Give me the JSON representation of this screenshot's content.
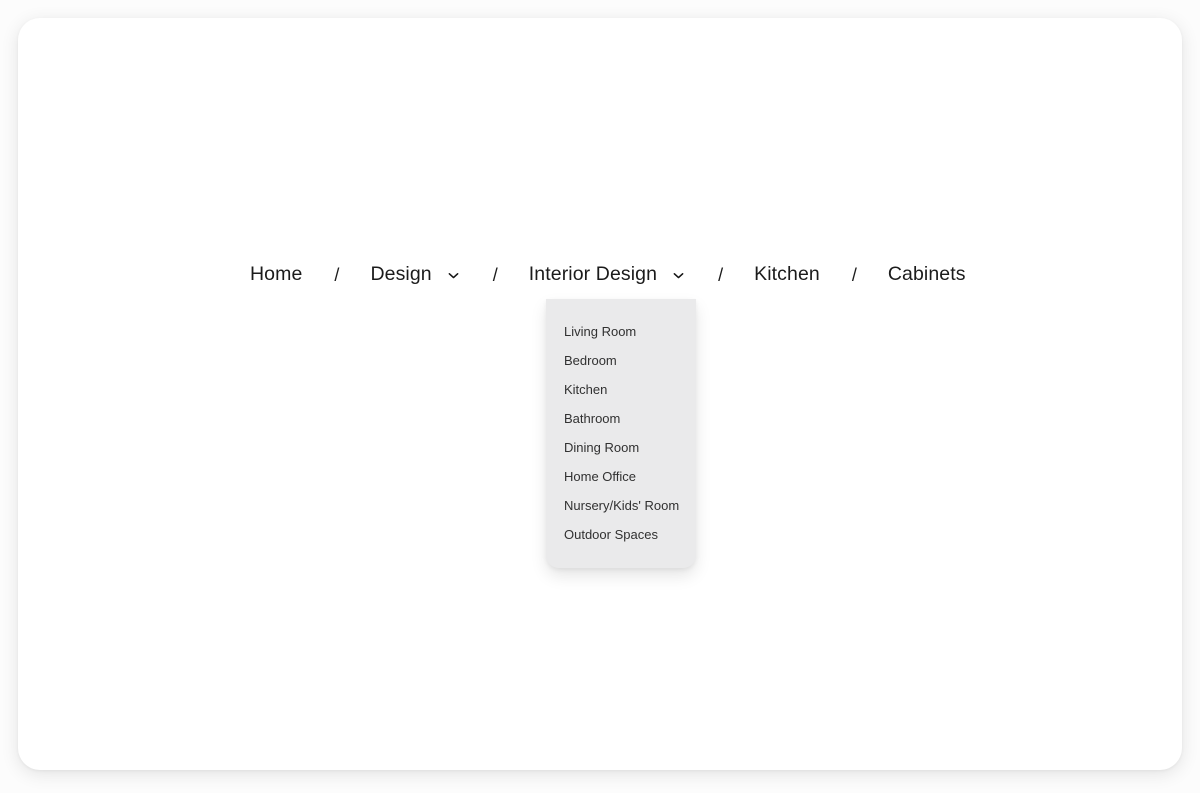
{
  "page": {
    "background_color": "#fcfcfc",
    "card_background_color": "#ffffff"
  },
  "breadcrumb": {
    "separator": "/",
    "items": [
      {
        "label": "Home",
        "has_chevron": false,
        "chevron_icon": "",
        "expanded": false
      },
      {
        "label": "Design",
        "has_chevron": true,
        "chevron_icon": "chevron-down-icon",
        "expanded": false
      },
      {
        "label": "Interior Design",
        "has_chevron": true,
        "chevron_icon": "chevron-down-icon",
        "expanded": true
      },
      {
        "label": "Kitchen",
        "has_chevron": false,
        "chevron_icon": "",
        "expanded": false
      },
      {
        "label": "Cabinets",
        "has_chevron": false,
        "chevron_icon": "",
        "expanded": false
      }
    ]
  },
  "dropdown": {
    "open_for": "Interior Design",
    "background_color": "#eaeaeb",
    "text_color": "#313131",
    "items": [
      {
        "label": "Living Room"
      },
      {
        "label": "Bedroom"
      },
      {
        "label": "Kitchen"
      },
      {
        "label": "Bathroom"
      },
      {
        "label": "Dining Room"
      },
      {
        "label": "Home Office"
      },
      {
        "label": "Nursery/Kids' Room"
      },
      {
        "label": "Outdoor Spaces"
      }
    ]
  }
}
